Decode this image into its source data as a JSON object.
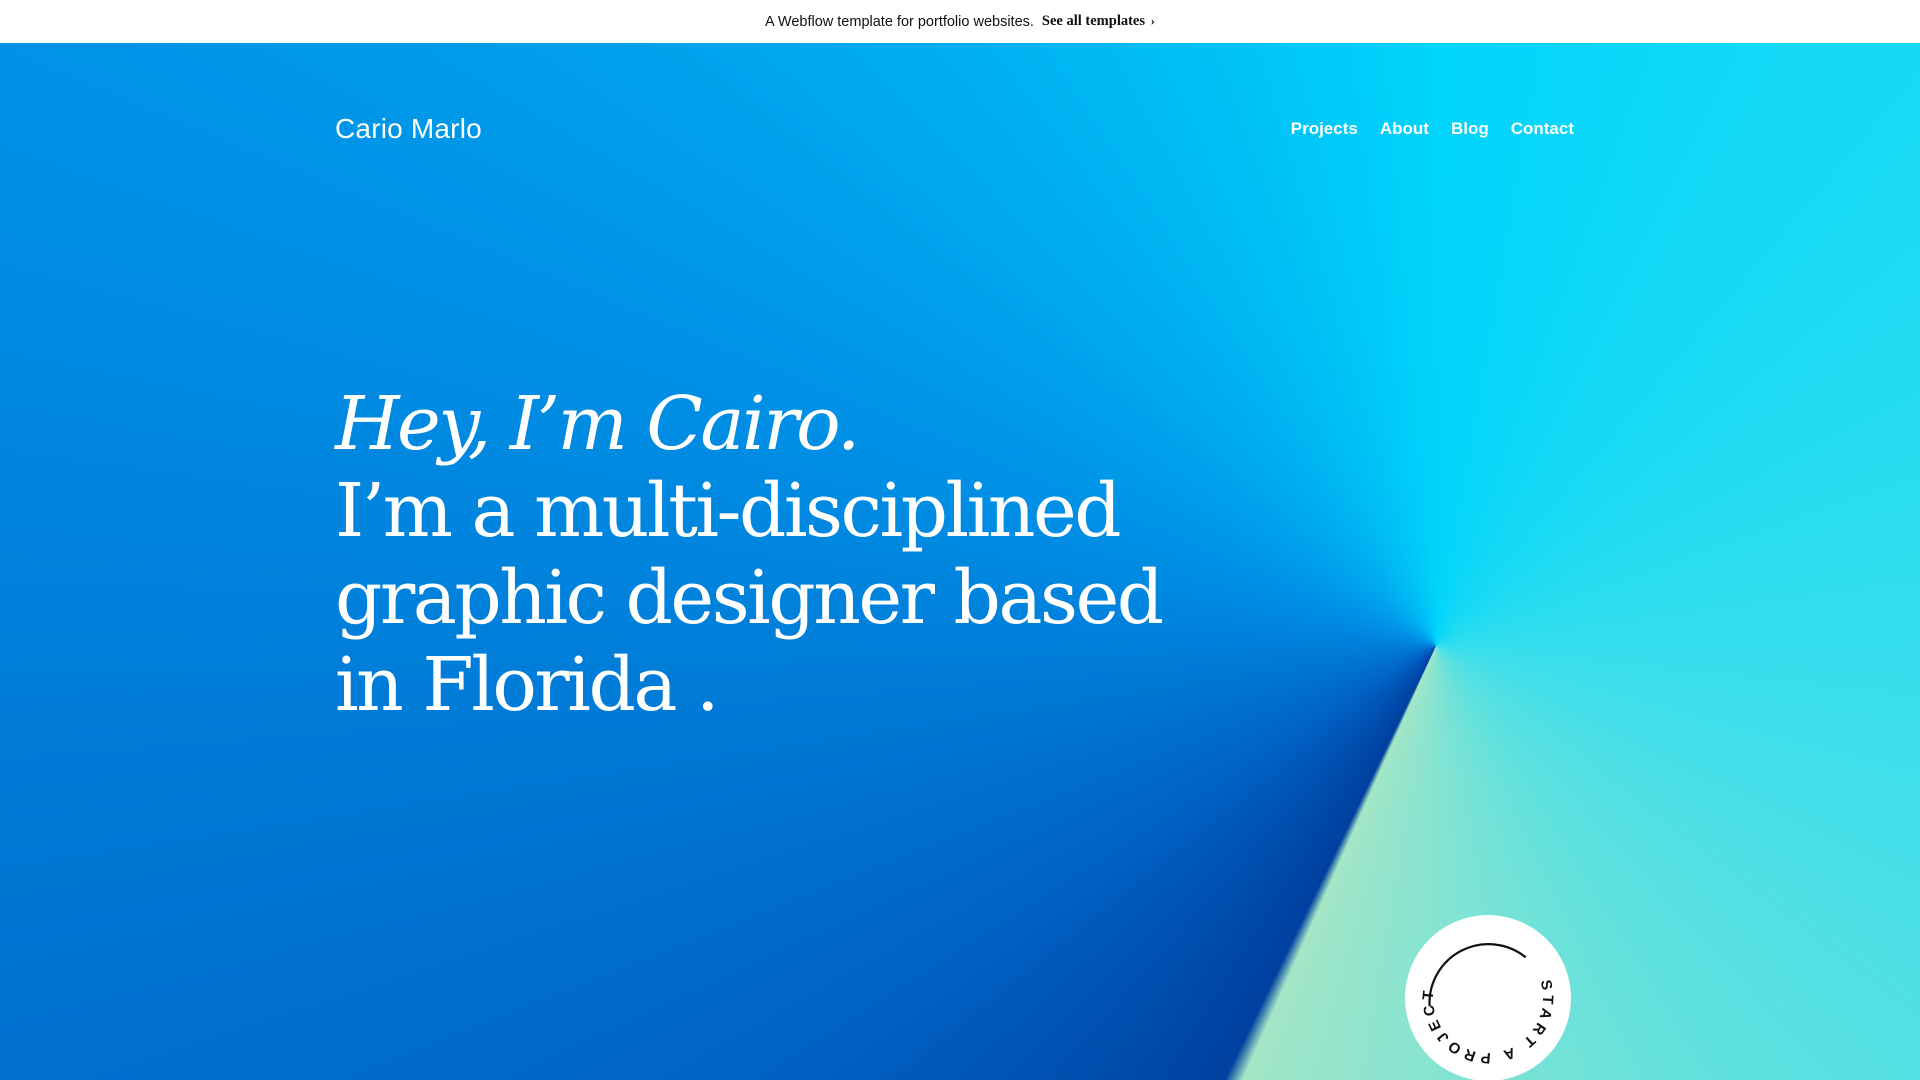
{
  "banner": {
    "text": "A Webflow template for portfolio websites.",
    "link_label": "See all templates",
    "link_chevron": "›"
  },
  "header": {
    "logo": "Cario Marlo",
    "nav": [
      "Projects",
      "About",
      "Blog",
      "Contact"
    ]
  },
  "hero": {
    "greeting": "Hey, I’m Cairo.",
    "line1": "I’m a multi-disciplined",
    "line2": "graphic designer based",
    "line3": "in Florida ."
  },
  "cta": {
    "label": "START A PROJECT",
    "icon": "circular-text-badge"
  },
  "colors": {
    "banner_bg": "#ffffff",
    "hero_blue": "#0070d8",
    "hero_cyan": "#00d4fb",
    "hero_mint": "#9ce5c9",
    "text": "#ffffff"
  }
}
